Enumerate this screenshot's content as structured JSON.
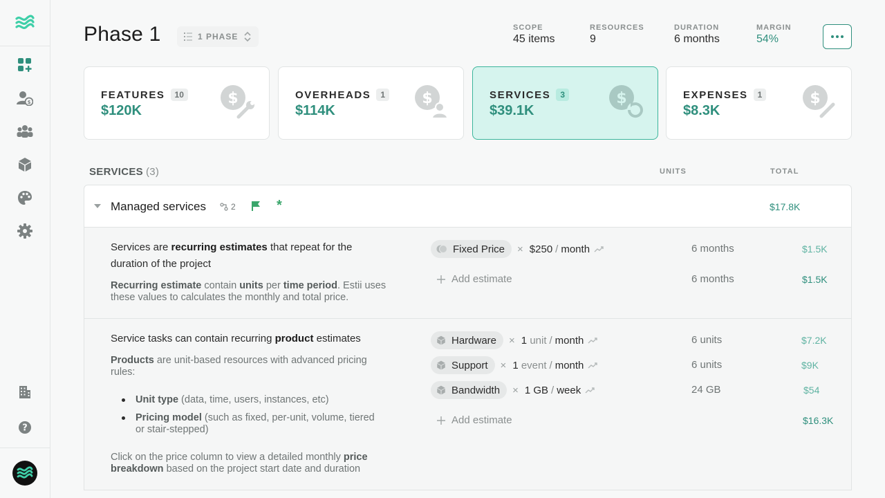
{
  "page": {
    "title": "Phase 1",
    "phase_selector": "1 PHASE"
  },
  "stats": [
    {
      "key": "SCOPE",
      "value": "45 items"
    },
    {
      "key": "RESOURCES",
      "value": "9"
    },
    {
      "key": "DURATION",
      "value": "6 months"
    },
    {
      "key": "MARGIN",
      "value": "54%"
    }
  ],
  "cards": [
    {
      "name": "FEATURES",
      "count": "10",
      "amount": "$120K"
    },
    {
      "name": "OVERHEADS",
      "count": "1",
      "amount": "$114K"
    },
    {
      "name": "SERVICES",
      "count": "3",
      "amount": "$39.1K"
    },
    {
      "name": "EXPENSES",
      "count": "1",
      "amount": "$8.3K"
    }
  ],
  "section": {
    "title": "SERVICES",
    "count": "(3)",
    "col_units": "UNITS",
    "col_total": "TOTAL"
  },
  "group": {
    "name": "Managed services",
    "link_count": "2",
    "star": "*",
    "total": "$17.8K"
  },
  "block1": {
    "desc_a": "Services are ",
    "desc_b": "recurring estimates",
    "desc_c": " that repeat for the duration of the project",
    "sub_a": "Recurring estimate",
    "sub_b": " contain ",
    "sub_c": "units",
    "sub_d": " per ",
    "sub_e": "time period",
    "sub_f": ". Estii uses these values to calculates the monthly and total price.",
    "estimate": {
      "chip": "Fixed Price",
      "qty": "$250",
      "unit": "",
      "period": "month",
      "units": "6 months",
      "total": "$1.5K"
    },
    "add_label": "Add estimate",
    "add_units": "6 months",
    "add_total": "$1.5K"
  },
  "block2": {
    "desc_a": "Service tasks can contain recurring ",
    "desc_b": "product",
    "desc_c": " estimates",
    "sub_a": "Products",
    "sub_b": " are unit-based resources with advanced pricing rules:",
    "bullet1_a": "Unit type",
    "bullet1_b": " (data, time, users, instances, etc)",
    "bullet2_a": "Pricing model",
    "bullet2_b": " (such as fixed, per-unit, volume, tiered or stair-stepped)",
    "foot_a": "Click on the price column to view a detailed monthly ",
    "foot_b": "price breakdown",
    "foot_c": " based on the project start date and duration",
    "estimates": [
      {
        "chip": "Hardware",
        "qty": "1",
        "unit": "unit",
        "period": "month",
        "units": "6 units",
        "total": "$7.2K"
      },
      {
        "chip": "Support",
        "qty": "1",
        "unit": "event",
        "period": "month",
        "units": "6 units",
        "total": "$9K"
      },
      {
        "chip": "Bandwidth",
        "qty": "1 GB",
        "unit": "",
        "period": "week",
        "units": "24 GB",
        "total": "$54"
      }
    ],
    "add_label": "Add estimate",
    "add_total": "$16.3K"
  },
  "colors": {
    "accent": "#2f8f7d",
    "accent_light": "#d6f4ee",
    "flag": "#3aa66b"
  }
}
